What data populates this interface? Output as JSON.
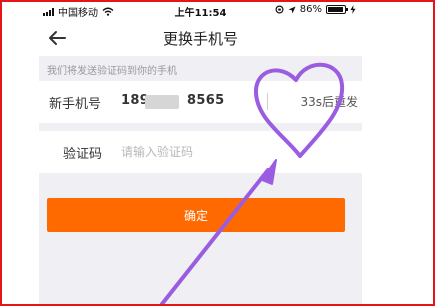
{
  "status_bar": {
    "carrier": "中国移动",
    "time": "上午11:54",
    "battery": "86%"
  },
  "nav": {
    "title": "更换手机号"
  },
  "hint": "我们将发送验证码到你的手机",
  "phone_row": {
    "label": "新手机号",
    "value_start": "189",
    "value_end": "8565",
    "resend": "33s后重发"
  },
  "code_row": {
    "label": "验证码",
    "placeholder": "请输入验证码",
    "value": ""
  },
  "confirm_button": "确定",
  "colors": {
    "accent": "#ff6a00",
    "annotation": "#9a5ce0",
    "frame": "#e8141c"
  }
}
